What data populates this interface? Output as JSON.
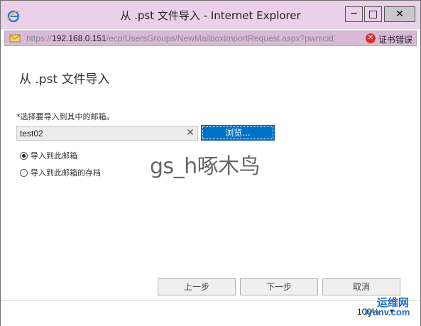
{
  "window": {
    "title": "从 .pst 文件导入 - Internet Explorer",
    "minimize_glyph": "─",
    "maximize_glyph": "□",
    "close_glyph": "✕"
  },
  "address_bar": {
    "url_prefix": "https://",
    "url_host": "192.168.0.151",
    "url_path": "/ecp/UsersGroups/NewMailboxImportRequest.aspx?pwmcid",
    "cert_error_label": "证书错误"
  },
  "dialog": {
    "title": "从 .pst 文件导入",
    "instruction": "*选择要导入到其中的邮箱。",
    "mailbox_value": "test02",
    "clear_glyph": "✕",
    "browse_label": "浏览...",
    "radio_options": [
      {
        "label": "导入到此邮箱",
        "checked": true
      },
      {
        "label": "导入到此邮箱的存档",
        "checked": false
      }
    ],
    "buttons": {
      "prev": "上一步",
      "next": "下一步",
      "cancel": "取消"
    }
  },
  "watermark": "gs_h啄木鸟",
  "status_bar": {
    "zoom": "100%"
  },
  "site_logo": {
    "name": "运维网",
    "url": "iyunv.com"
  },
  "colors": {
    "title_bar_bg": "#ead0e9",
    "browse_button_bg": "#0072c6",
    "cert_error_icon": "#d8312b"
  }
}
